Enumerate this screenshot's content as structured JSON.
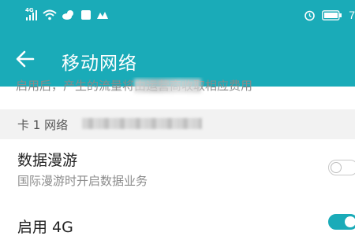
{
  "status_bar": {
    "network_type": "4G",
    "time_partial": "7",
    "icons": [
      "signal-4g-icon",
      "wifi-icon",
      "weather-icon",
      "app-notification-icon",
      "app-notification-icon-2",
      "alarm-icon",
      "battery-icon"
    ]
  },
  "app_bar": {
    "title": "移动网络",
    "back_icon": "arrow-back-icon"
  },
  "clipped_description": "启用后，产生的流量将由运营商收取相应费用",
  "section": {
    "label": "卡 1 网络"
  },
  "settings": [
    {
      "title": "数据漫游",
      "subtitle": "国际漫游时开启数据业务",
      "enabled": false
    },
    {
      "title": "启用 4G",
      "enabled": true
    }
  ],
  "colors": {
    "accent": "#1aabb8",
    "section_bg": "#f2f2f2",
    "text_primary": "#222222",
    "text_secondary": "#8c8c8c"
  }
}
